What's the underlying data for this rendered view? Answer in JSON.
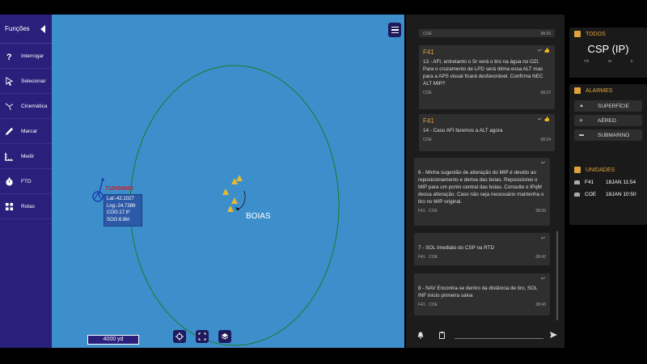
{
  "sidebar": {
    "header": "Funções",
    "items": [
      {
        "label": "Interrogar",
        "icon": "question-icon"
      },
      {
        "label": "Selecionar",
        "icon": "cursor-icon"
      },
      {
        "label": "Cinemática",
        "icon": "kinematics-icon"
      },
      {
        "label": "Marcar",
        "icon": "pencil-icon"
      },
      {
        "label": "Medir",
        "icon": "ruler-icon"
      },
      {
        "label": "FTD",
        "icon": "timer-icon"
      },
      {
        "label": "Rotas",
        "icon": "route-icon"
      }
    ]
  },
  "map": {
    "track_id": "710454000",
    "track_info": [
      "Lat:-42.1027",
      "Lng:-24.7389",
      "COG:17.6°",
      "SOG:6.8kt"
    ],
    "target_label": "BOIAS",
    "scale": "4000 yd",
    "circle_color": "#1a7a2a",
    "water_color": "#3d8fcc",
    "buoy_color": "#e8b830"
  },
  "chat": {
    "messages": [
      {
        "from": "",
        "text": "",
        "sender": "COE",
        "time": "08:20"
      },
      {
        "from": "F41",
        "text": "13 - AFI, entretanto o Sr verá o tiro na água no OZI. Para o cruzamento de LPD será ótima essa ALT mas para a APS visual ficará desfavorável. Confirma NEC ALT MIP?",
        "sender": "COE",
        "time": "08:22"
      },
      {
        "from": "F41",
        "text": "14 - Caso AFI faremos a ALT agora",
        "sender": "COE",
        "time": "08:24"
      },
      {
        "from": "",
        "text": "6 - Minha sugestão de alteração do MIP é devido ao reposicionamento e deriva das boias. Reposicionei o MIP para um ponto central das boias. Consulte o IPqM dessa alteração. Caso não seja necessário mantenha o tiro no MIP original.",
        "sender": "F41",
        "sender2": "COE",
        "time": "08:26"
      },
      {
        "from": "",
        "text": "7 - SOL Imediato do CSP na RTD",
        "sender": "F41",
        "sender2": "COE",
        "time": "08:42"
      },
      {
        "from": "",
        "text": "8 - NAV Encontra-se dentro da distância de tiro, SOL INF início primeira salva",
        "sender": "F41",
        "sender2": "COE",
        "time": "08:43"
      }
    ]
  },
  "todos": {
    "title": "TODOS",
    "name": "CSP (IP)",
    "stats": [
      "T/0",
      "W",
      "0"
    ]
  },
  "alarmes": {
    "title": "ALARMES",
    "items": [
      "SUPERFÍCIE",
      "AÉREO",
      "SUBMARINO"
    ]
  },
  "unidades": {
    "title": "UNIDADES",
    "items": [
      {
        "name": "F41",
        "time": "18JAN 11:54"
      },
      {
        "name": "COE",
        "time": "18JAN 10:50"
      }
    ]
  },
  "accent": "#e0a23a"
}
